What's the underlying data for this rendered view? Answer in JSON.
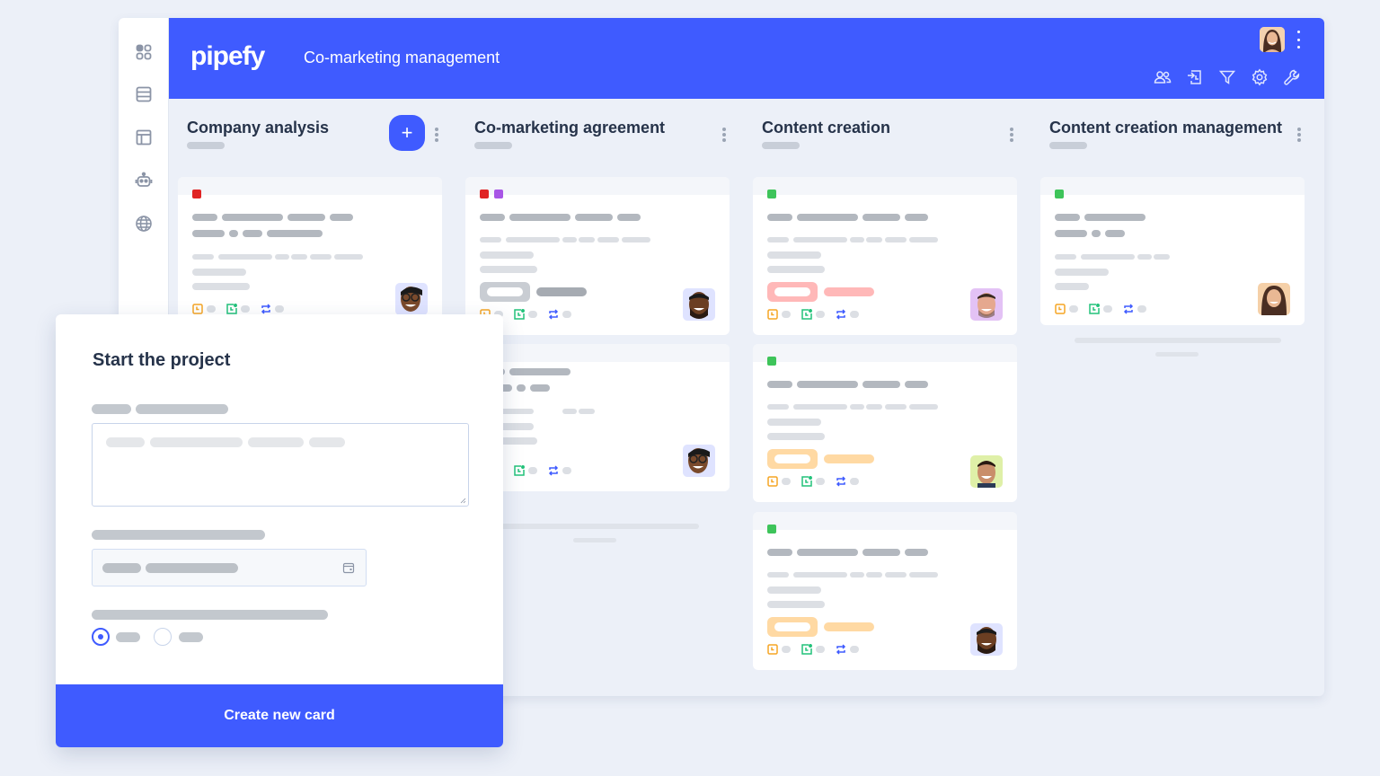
{
  "app": {
    "logo": "pipefy",
    "title": "Co-marketing management"
  },
  "rail": {
    "items": [
      {
        "icon": "apps-grid-icon"
      },
      {
        "icon": "database-icon"
      },
      {
        "icon": "layout-icon"
      },
      {
        "icon": "robot-icon"
      },
      {
        "icon": "globe-icon"
      }
    ]
  },
  "header_tools": [
    "members-icon",
    "import-icon",
    "filter-icon",
    "settings-gear-icon",
    "wrench-icon"
  ],
  "phases": [
    {
      "title": "Company analysis",
      "has_add_button": true,
      "add_label": "+"
    },
    {
      "title": "Co-marketing agreement",
      "has_add_button": false
    },
    {
      "title": "Content creation",
      "has_add_button": false
    },
    {
      "title": "Content creation management",
      "has_add_button": false
    }
  ],
  "colors": {
    "accent": "#3f5bff",
    "tag_red": "#e02424",
    "tag_purple": "#a855e6",
    "tag_green": "#3ec45a",
    "label_gray": "#c9cdd3",
    "label_red": "#ffb8b8",
    "label_orange": "#ffd9a3",
    "icon_orange": "#f5a524",
    "icon_green": "#22c27a",
    "icon_blue": "#3f5bff"
  },
  "modal": {
    "title": "Start the project",
    "button": "Create new card",
    "radio_selected_index": 0
  }
}
